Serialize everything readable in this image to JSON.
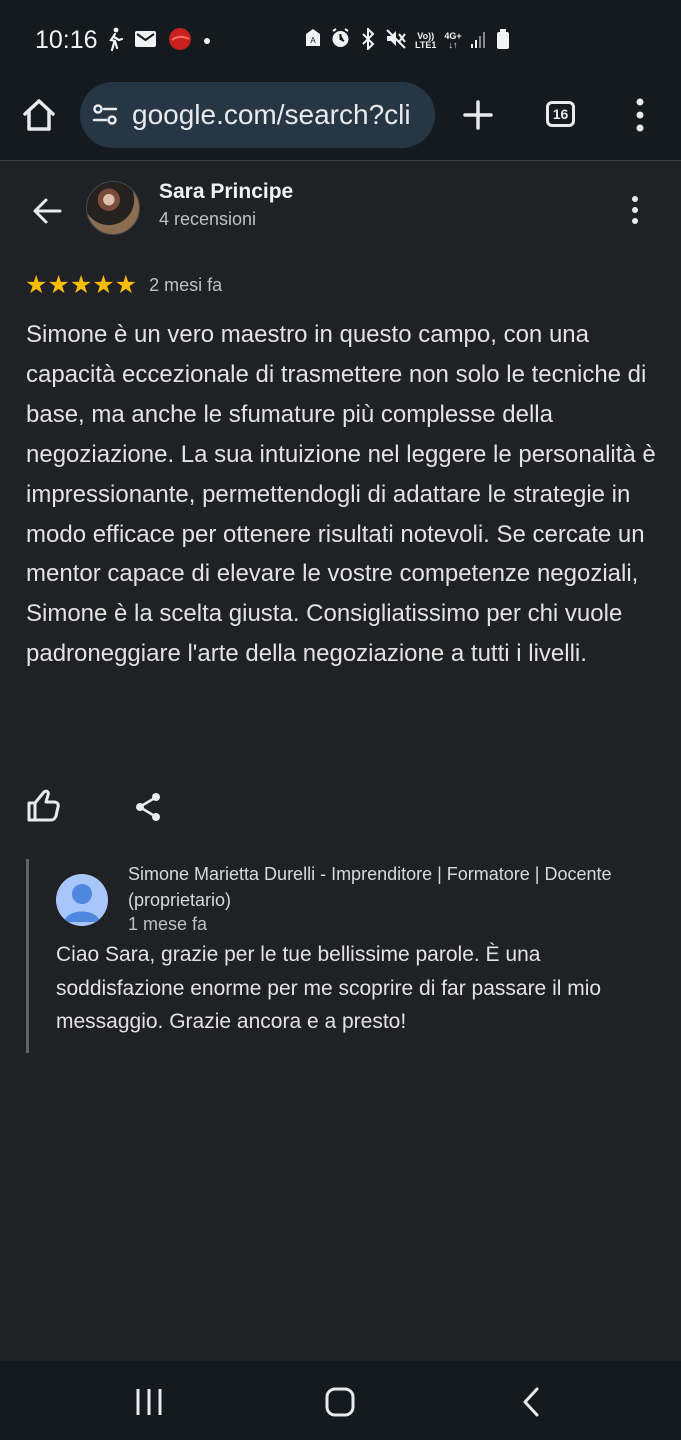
{
  "status": {
    "time": "10:16",
    "network_top": "Vo))",
    "network_bottom": "LTE1",
    "cell_label": "4G+",
    "cell_arrows": "↓↑"
  },
  "browser": {
    "url": "google.com/search?cli",
    "tabs_count": "16",
    "icons": [
      "home-icon",
      "site-settings-icon",
      "plus-icon",
      "tabs-icon",
      "more-vertical-icon"
    ]
  },
  "review": {
    "reviewer_name": "Sara Principe",
    "reviewer_review_count": "4 recensioni",
    "stars_text": "★★★★★",
    "rating": 5,
    "date": "2 mesi fa",
    "text": "Simone è un vero maestro in questo campo, con una capacità eccezionale di trasmettere non solo le tecniche di base, ma anche le sfumature più complesse della negoziazione. La sua intuizione nel leggere le personalità è impressionante, permettendogli di adattare le strategie in modo efficace per ottenere risultati notevoli. Se cercate un mentor capace di elevare le vostre competenze negoziali, Simone è la scelta giusta. Consigliatissimo per chi vuole padroneggiare l'arte della negoziazione a tutti i livelli."
  },
  "reply": {
    "owner_name": "Simone Marietta Durelli - Imprenditore | Formatore | Docente (proprietario)",
    "date": "1 mese fa",
    "text": "Ciao Sara, grazie per le tue bellissime parole. È una soddisfazione enorme per me scoprire di far passare il mio messaggio. Grazie ancora e a presto!"
  },
  "colors": {
    "background": "#202124",
    "top_bar": "#141a20",
    "address_bar": "#273645",
    "star": "#fbbc04",
    "owner_avatar": "#a7c7fa"
  }
}
